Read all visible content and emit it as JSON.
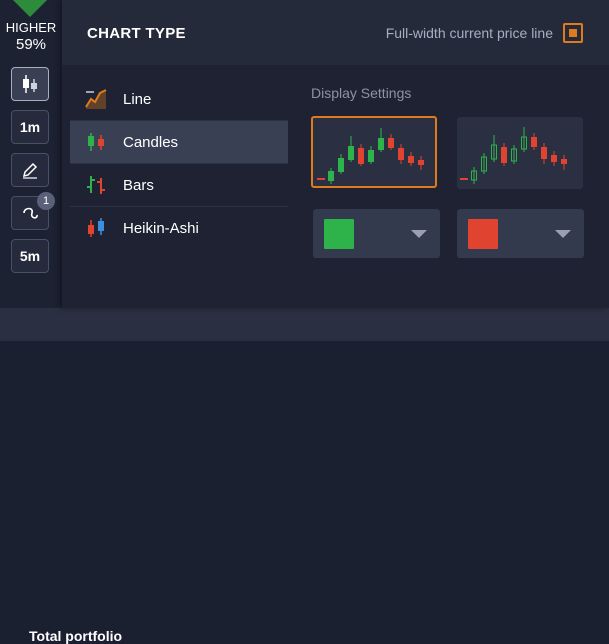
{
  "sidebar": {
    "higher_label": "HIGHER",
    "higher_pct": "59%",
    "tools": [
      {
        "name": "candles-tool-icon"
      },
      {
        "label": "1m"
      },
      {
        "name": "pencil-icon"
      },
      {
        "name": "indicator-icon",
        "badge": "1"
      },
      {
        "label": "5m"
      }
    ]
  },
  "footer": {
    "portfolio_label": "Total portfolio"
  },
  "popup": {
    "title": "CHART TYPE",
    "fullwidth_label": "Full-width current price line",
    "fullwidth_checked": true,
    "types": [
      {
        "label": "Line",
        "icon": "line-chart-icon",
        "selected": false
      },
      {
        "label": "Candles",
        "icon": "candles-icon",
        "selected": true
      },
      {
        "label": "Bars",
        "icon": "bars-icon",
        "selected": false
      },
      {
        "label": "Heikin-Ashi",
        "icon": "heikin-ashi-icon",
        "selected": false
      }
    ],
    "display_settings_title": "Display Settings",
    "styles": [
      {
        "name": "filled-candles",
        "selected": true
      },
      {
        "name": "hollow-candles",
        "selected": false
      }
    ],
    "up_color": "#2eb34a",
    "down_color": "#e0432f"
  },
  "colors": {
    "accent": "#e07b1d",
    "up": "#2eb34a",
    "down": "#e0432f"
  }
}
